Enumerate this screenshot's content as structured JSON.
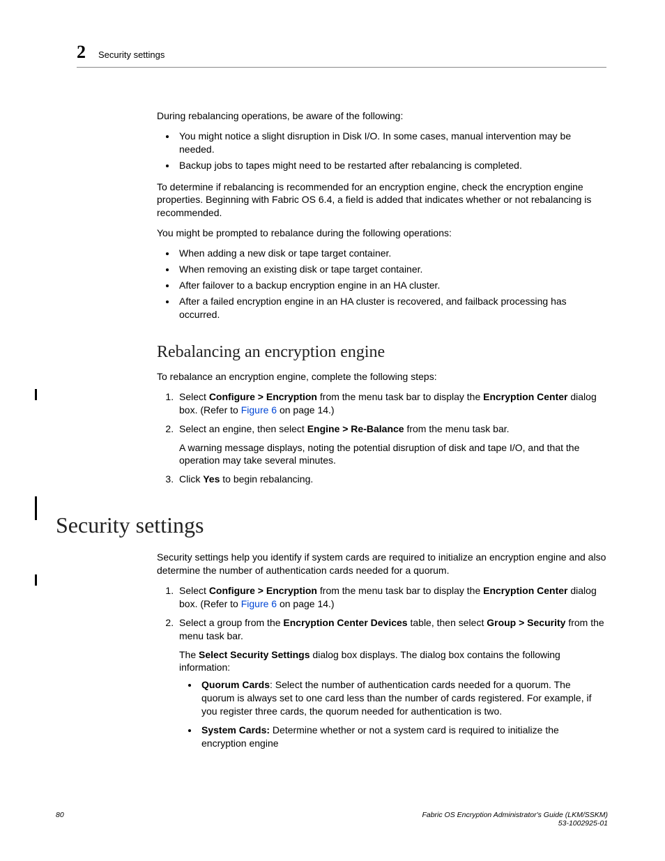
{
  "header": {
    "chapter_number": "2",
    "running_title": "Security settings"
  },
  "intro": {
    "p1": "During rebalancing operations, be aware of the following:",
    "bullets1": {
      "b1": "You might notice a slight disruption in Disk I/O. In some cases, manual intervention may be needed.",
      "b2": "Backup jobs to tapes might need to be restarted after rebalancing is completed."
    },
    "p2": "To determine if rebalancing is recommended for an encryption engine, check the encryption engine properties. Beginning with Fabric OS 6.4, a field is added that indicates whether or not rebalancing is recommended.",
    "p3": "You might be prompted to rebalance during the following operations:",
    "bullets2": {
      "b1": "When adding a new disk or tape target container.",
      "b2": "When removing an existing disk or tape target container.",
      "b3": "After failover to a backup encryption engine in an HA cluster.",
      "b4": "After a failed encryption engine in an HA cluster is recovered, and failback processing has occurred."
    }
  },
  "sec_rebalance": {
    "heading": "Rebalancing an encryption engine",
    "intro": "To rebalance an encryption engine, complete the following steps:",
    "step1": {
      "pre": "Select ",
      "menu": "Configure > Encryption",
      "mid": " from the menu task bar to display the ",
      "dlg": "Encryption Center",
      "post": " dialog box. (Refer to ",
      "figref": "Figure 6",
      "tail": " on page 14.)"
    },
    "step2": {
      "pre": "Select an engine, then select ",
      "menu": "Engine > Re-Balance",
      "post": " from the menu task bar.",
      "note": "A warning message displays, noting the potential disruption of disk and tape I/O, and that the operation may take several minutes."
    },
    "step3": {
      "pre": "Click ",
      "btn": "Yes",
      "post": " to begin rebalancing."
    }
  },
  "sec_security": {
    "heading": "Security settings",
    "intro": "Security settings help you identify if system cards are required to initialize an encryption engine and also determine the number of authentication cards needed for a quorum.",
    "step1": {
      "pre": "Select ",
      "menu": "Configure > Encryption",
      "mid": " from the menu task bar to display the ",
      "dlg": "Encryption Center",
      "post": " dialog box. (Refer to ",
      "figref": "Figure 6",
      "tail": " on page 14.)"
    },
    "step2": {
      "pre": "Select a group from the ",
      "tbl": "Encryption Center Devices",
      "mid": " table, then select ",
      "menu": "Group > Security",
      "post": " from the menu task bar.",
      "note_pre": "The ",
      "note_dlg": "Select Security Settings",
      "note_post": " dialog box displays. The dialog box contains the following information:",
      "sub1_label": "Quorum Cards",
      "sub1_text": ": Select the number of authentication cards needed for a quorum. The quorum is always set to one card less than the number of cards registered. For example, if you register three cards, the quorum needed for authentication is two.",
      "sub2_label": "System Cards:",
      "sub2_text": " Determine whether or not a system card is required to initialize the encryption engine"
    }
  },
  "footer": {
    "page": "80",
    "title": "Fabric OS Encryption Administrator's Guide  (LKM/SSKM)",
    "docnum": "53-1002925-01"
  }
}
